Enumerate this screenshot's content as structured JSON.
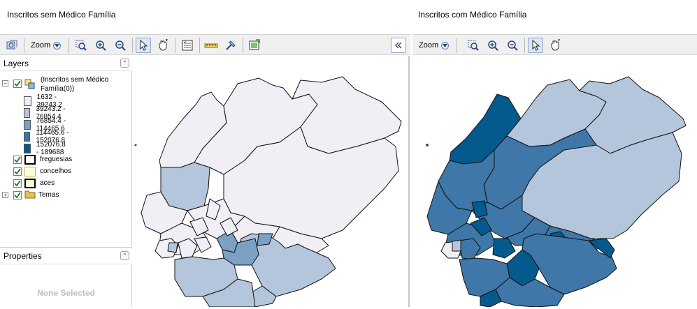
{
  "left_view": {
    "title": "Inscritos sem Médico Família",
    "zoom_label": "Zoom"
  },
  "right_view": {
    "title": "Inscritos com Médico Família",
    "zoom_label": "Zoom"
  },
  "layers": {
    "heading": "Layers",
    "group_label": "(Inscritos sem Médico Família(0))",
    "legend": [
      {
        "label": "1632 - 39243.2",
        "color": "#f1eef6"
      },
      {
        "label": "39243.2 - 76854.4",
        "color": "#b4c6dc"
      },
      {
        "label": "76854.4 - 114465.6",
        "color": "#7ba1c5"
      },
      {
        "label": "114465.6 - 152076.8",
        "color": "#3e77a8"
      },
      {
        "label": "152076.8 - 189688",
        "color": "#045a8d"
      }
    ],
    "items": [
      {
        "label": "freguesias"
      },
      {
        "label": "concelhos"
      },
      {
        "label": "aces"
      },
      {
        "label": "Temas"
      }
    ]
  },
  "properties": {
    "heading": "Properties",
    "empty_text": "None Selected"
  }
}
